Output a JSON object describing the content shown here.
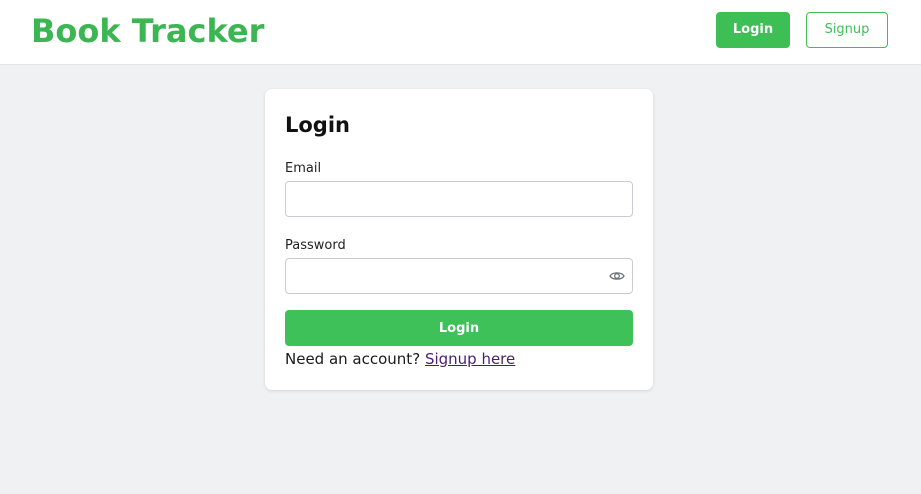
{
  "header": {
    "brand": "Book Tracker",
    "login_label": "Login",
    "signup_label": "Signup"
  },
  "form": {
    "title": "Login",
    "email_label": "Email",
    "email_value": "",
    "password_label": "Password",
    "password_value": "",
    "password_toggle_icon": "eye-icon",
    "submit_label": "Login",
    "account_prompt": "Need an account?",
    "signup_link": "Signup here"
  },
  "colors": {
    "brand_green": "#3cb553",
    "button_green": "#3dbf55",
    "page_background": "#f0f1f3",
    "link_purple": "#4b1f6f"
  }
}
